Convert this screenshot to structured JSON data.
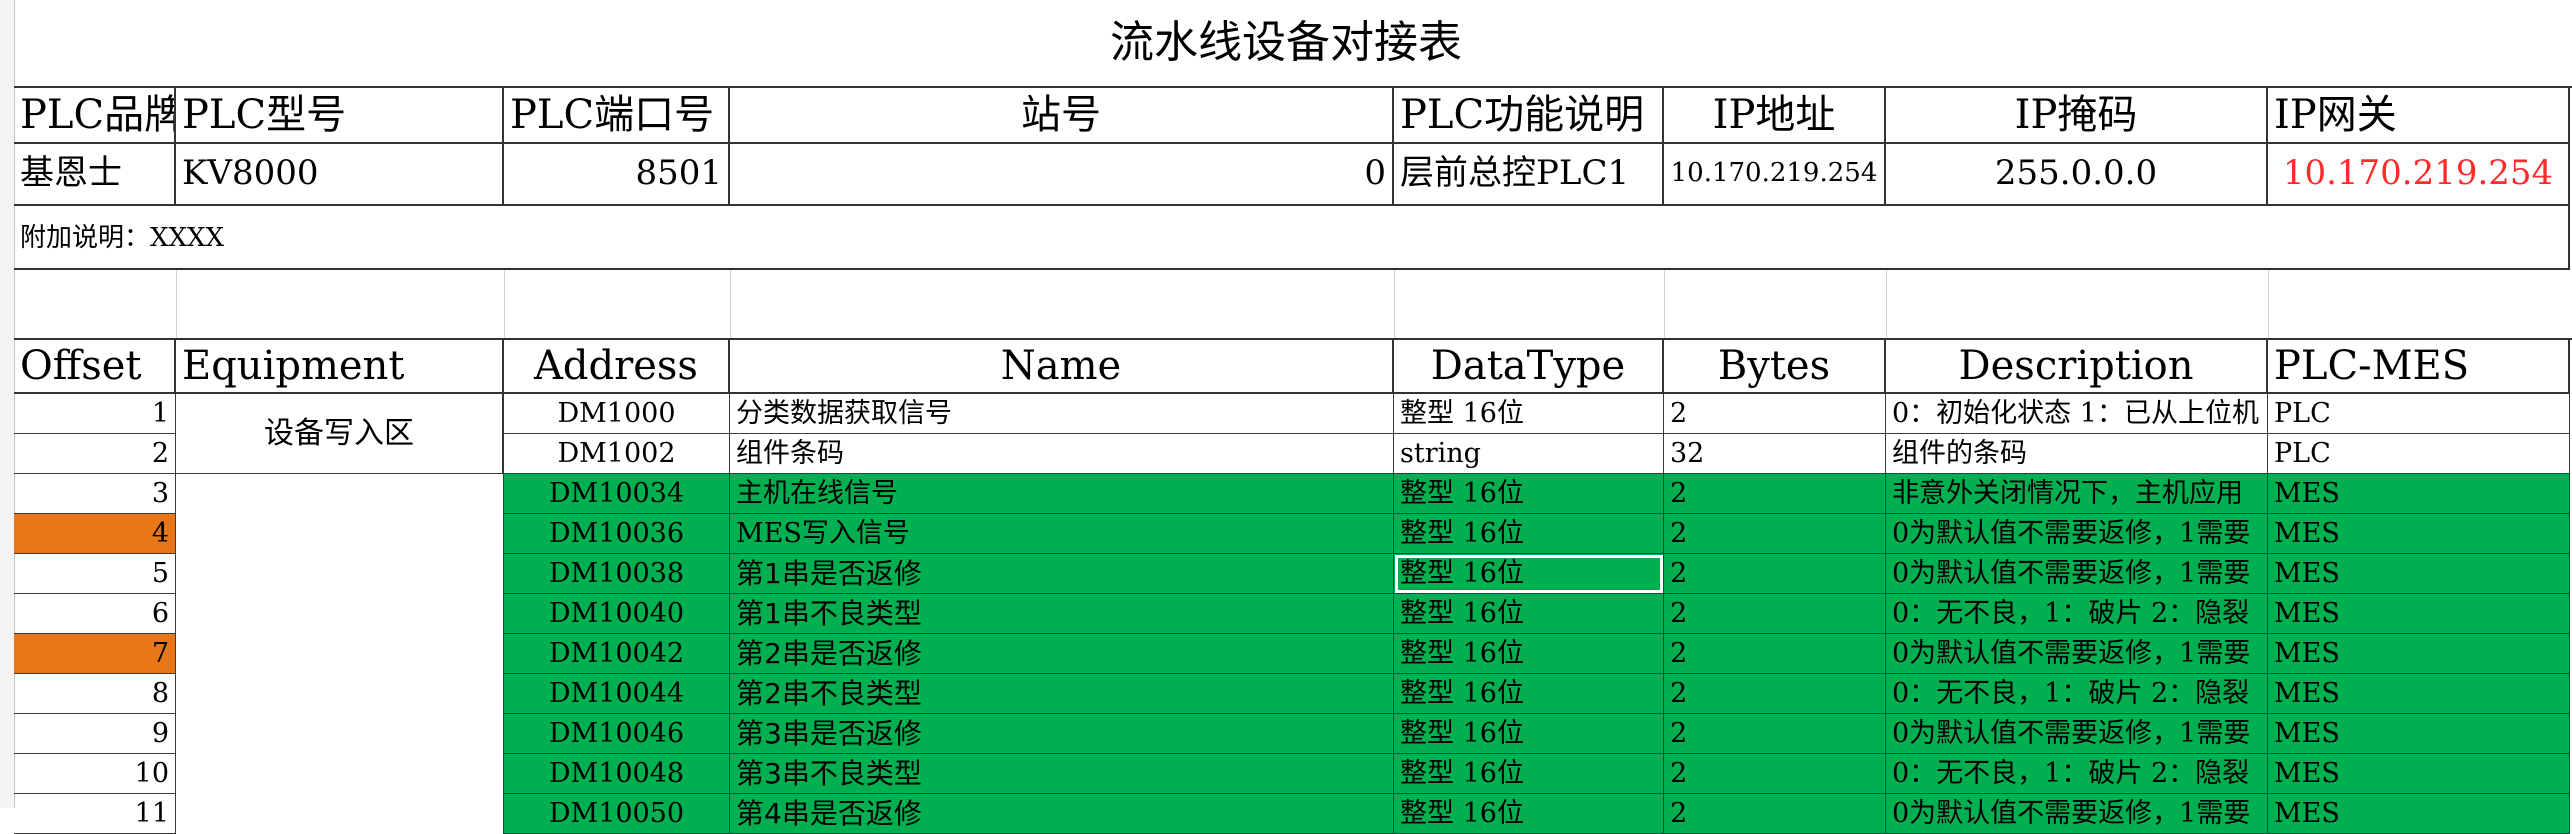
{
  "title": "流水线设备对接表",
  "plc_header": [
    "PLC品牌",
    "PLC型号",
    "PLC端口号",
    "站号",
    "PLC功能说明",
    "IP地址",
    "IP掩码",
    "IP网关"
  ],
  "plc_values": {
    "brand": "基恩士",
    "model": "KV8000",
    "port": "8501",
    "station": "0",
    "function": "层前总控PLC1",
    "ip": "10.170.219.254",
    "mask": "255.0.0.0",
    "gateway": "10.170.219.254"
  },
  "note": "附加说明：XXXX",
  "columns": [
    "Offset",
    "Equipment",
    "Address",
    "Name",
    "DataType",
    "Bytes",
    "Description",
    "PLC-MES"
  ],
  "merged_equipment": "设备写入区",
  "rows": [
    {
      "offset": "1",
      "address": "DM1000",
      "name": "分类数据获取信号",
      "type": "整型 16位",
      "bytes": "2",
      "desc": "0：初始化状态 1：已从上位机",
      "dir": "PLC"
    },
    {
      "offset": "2",
      "address": "DM1002",
      "name": "组件条码",
      "type": "string",
      "bytes": "32",
      "desc": "组件的条码",
      "dir": "PLC"
    },
    {
      "offset": "3",
      "address": "DM10034",
      "name": "主机在线信号",
      "type": "整型 16位",
      "bytes": "2",
      "desc": "非意外关闭情况下，主机应用",
      "dir": "MES"
    },
    {
      "offset": "4",
      "address": "DM10036",
      "name": "MES写入信号",
      "type": "整型 16位",
      "bytes": "2",
      "desc": "0为默认值不需要返修，1需要",
      "dir": "MES"
    },
    {
      "offset": "5",
      "address": "DM10038",
      "name": "第1串是否返修",
      "type": "整型 16位",
      "bytes": "2",
      "desc": "0为默认值不需要返修，1需要",
      "dir": "MES"
    },
    {
      "offset": "6",
      "address": "DM10040",
      "name": "第1串不良类型",
      "type": "整型 16位",
      "bytes": "2",
      "desc": "0：无不良，1：破片 2：隐裂",
      "dir": "MES"
    },
    {
      "offset": "7",
      "address": "DM10042",
      "name": "第2串是否返修",
      "type": "整型 16位",
      "bytes": "2",
      "desc": "0为默认值不需要返修，1需要",
      "dir": "MES"
    },
    {
      "offset": "8",
      "address": "DM10044",
      "name": "第2串不良类型",
      "type": "整型 16位",
      "bytes": "2",
      "desc": "0：无不良，1：破片 2：隐裂",
      "dir": "MES"
    },
    {
      "offset": "9",
      "address": "DM10046",
      "name": "第3串是否返修",
      "type": "整型 16位",
      "bytes": "2",
      "desc": "0为默认值不需要返修，1需要",
      "dir": "MES"
    },
    {
      "offset": "10",
      "address": "DM10048",
      "name": "第3串不良类型",
      "type": "整型 16位",
      "bytes": "2",
      "desc": "0：无不良，1：破片 2：隐裂",
      "dir": "MES"
    },
    {
      "offset": "11",
      "address": "DM10050",
      "name": "第4串是否返修",
      "type": "整型 16位",
      "bytes": "2",
      "desc": "0为默认值不需要返修，1需要",
      "dir": "MES"
    }
  ],
  "colors": {
    "green": "#00b050",
    "orange": "#e97716",
    "red": "#ff2a2a"
  }
}
